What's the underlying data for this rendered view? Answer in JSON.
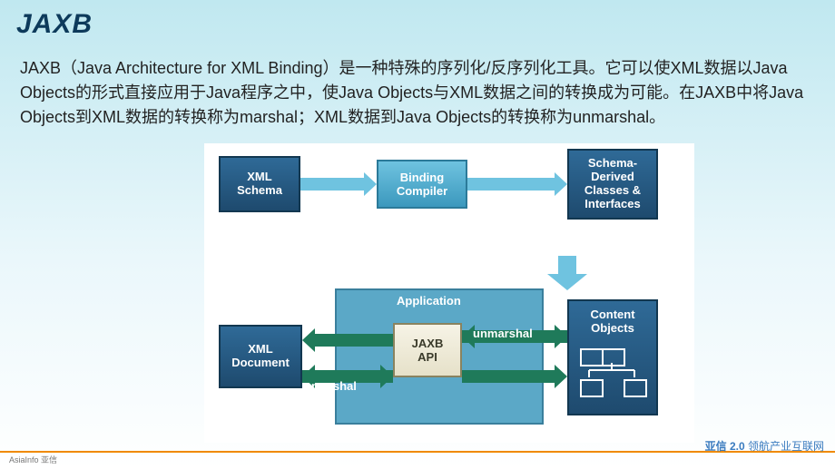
{
  "title": "JAXB",
  "paragraph": "JAXB（Java Architecture for XML Binding）是一种特殊的序列化/反序列化工具。它可以使XML数据以Java Objects的形式直接应用于Java程序之中，使Java Objects与XML数据之间的转换成为可能。在JAXB中将Java Objects到XML数据的转换称为marshal；XML数据到Java Objects的转换称为unmarshal。",
  "diagram": {
    "boxes": {
      "xml_schema": "XML\nSchema",
      "binding_compiler": "Binding\nCompiler",
      "schema_derived": "Schema-\nDerived\nClasses &\nInterfaces",
      "application": "Application",
      "jaxb_api": "JAXB\nAPI",
      "xml_document": "XML\nDocument",
      "content_objects": "Content\nObjects"
    },
    "arrows": {
      "unmarshal": "unmarshal",
      "marshal": "marshal"
    }
  },
  "footer": {
    "logo": "AsiaInfo 亚信",
    "brand": "亚信 2.0",
    "tagline": "领航产业互联网"
  }
}
